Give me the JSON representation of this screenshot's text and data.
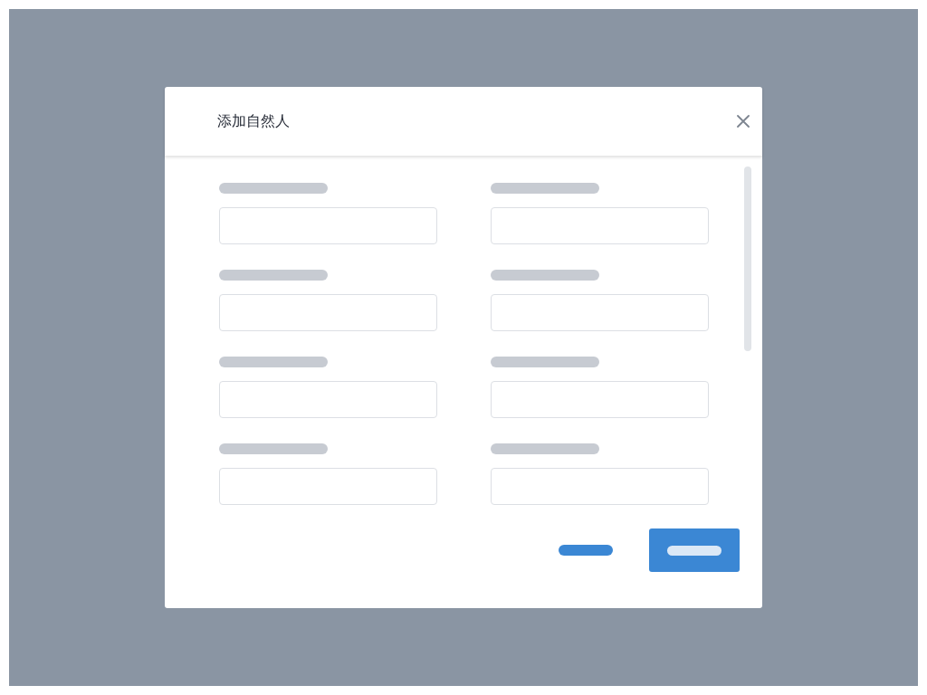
{
  "dialog": {
    "title": "添加自然人",
    "fields": [
      {
        "kind": "text-input"
      },
      {
        "kind": "text-input"
      },
      {
        "kind": "text-input"
      },
      {
        "kind": "text-input"
      },
      {
        "kind": "text-input"
      },
      {
        "kind": "text-input"
      },
      {
        "kind": "text-input"
      },
      {
        "kind": "text-input"
      }
    ],
    "buttons": [
      {
        "kind": "text"
      },
      {
        "kind": "primary"
      }
    ]
  }
}
